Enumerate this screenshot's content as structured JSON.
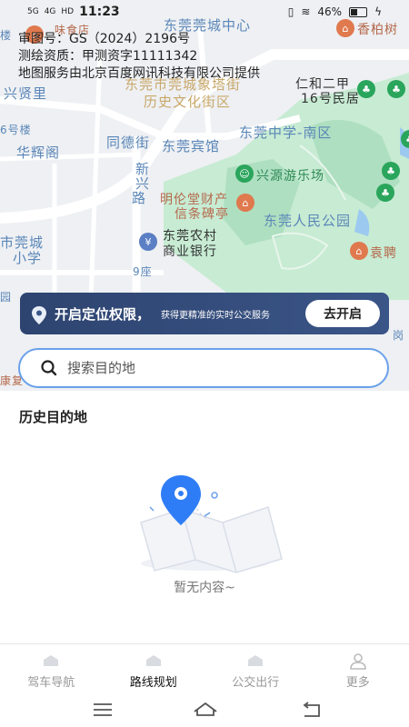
{
  "status_bar": {
    "signal_1": "5G",
    "signal_2": "4G",
    "hd": "HD",
    "time": "11:23",
    "battery": "46%"
  },
  "map": {
    "copyright_lines": [
      "审图号：GS（2024）2196号",
      "测绘资质：甲测资字11111342",
      "地图服务由北京百度网讯科技有限公司提供"
    ],
    "labels": {
      "dongguan_guancheng_center": "东莞莞城中心",
      "xiangbaishu": "香柏树",
      "weishidian": "味食店",
      "xinxianli": "兴贤里",
      "xiangta_street": "东莞市莞城象塔街",
      "historic_district": "历史文化街区",
      "renhe": "仁和二甲",
      "renhe2": "16号民居",
      "building6": "6号楼",
      "huahuige": "华辉阁",
      "tongde_street": "同德街",
      "binguan": "东莞宾馆",
      "middle_school": "东莞中学-南区",
      "xinxin_road": "新",
      "xinxin_road2": "兴",
      "xinxin_road3": "路",
      "xingyuan_park": "兴源游乐场",
      "minglun_1": "明伦堂财产",
      "minglun_2": "信条碑亭",
      "people_park": "东莞人民公园",
      "rcb_1": "东莞农村",
      "rcb_2": "商业银行",
      "guancheng_1": "市莞城",
      "guancheng_2": "小学",
      "building9": "9座",
      "yuanpin": "袁聘",
      "lou": "楼",
      "yuan": "园",
      "kangfu": "康复",
      "gang": "岗"
    }
  },
  "location_banner": {
    "title": "开启定位权限，",
    "subtitle": "获得更精准的实时公交服务",
    "button": "去开启"
  },
  "search": {
    "placeholder": "搜索目的地"
  },
  "history": {
    "title": "历史目的地",
    "empty_text": "暂无内容~"
  },
  "tabs": [
    {
      "label": "驾车导航",
      "icon": "car-icon"
    },
    {
      "label": "路线规划",
      "icon": "route-icon"
    },
    {
      "label": "公交出行",
      "icon": "bus-icon"
    },
    {
      "label": "更多",
      "icon": "user-icon"
    }
  ],
  "active_tab": "路线规划",
  "colors": {
    "accent_blue": "#2f7df6",
    "banner_bg": "#2e4470",
    "park_green": "#c7ebd3"
  }
}
